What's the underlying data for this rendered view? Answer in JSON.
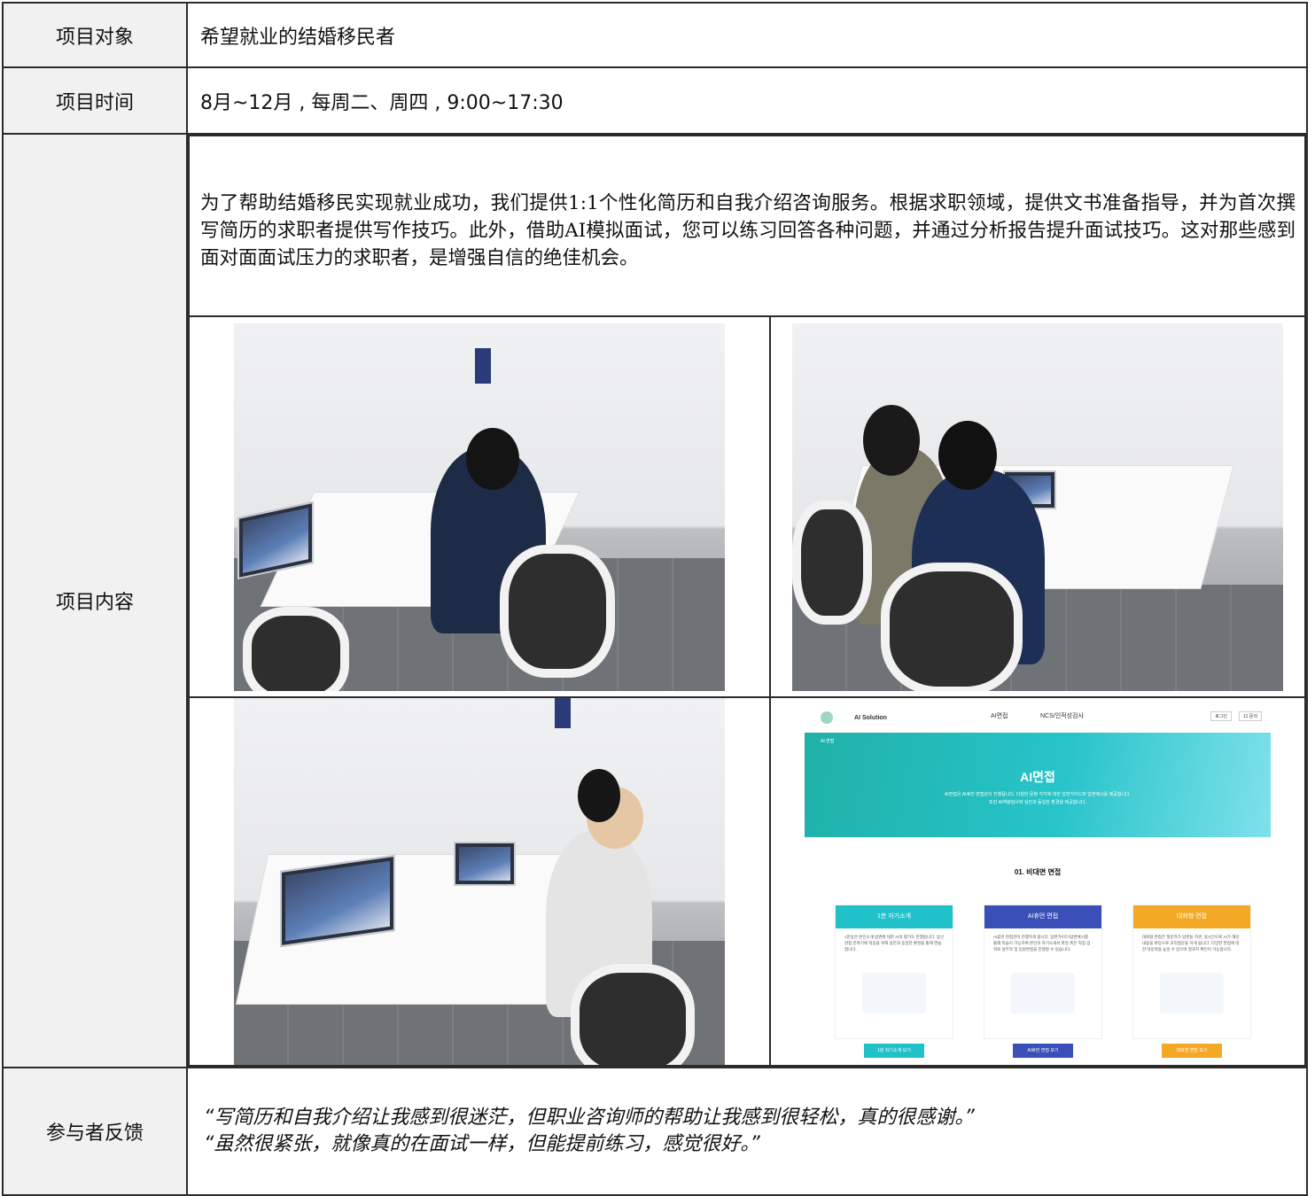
{
  "rows": {
    "target": {
      "label": "项目对象",
      "value": "希望就业的结婚移民者"
    },
    "time": {
      "label": "项目时间",
      "value": "8月~12月 , 每周二、周四 , 9:00~17:30"
    },
    "content": {
      "label": "项目内容",
      "paragraph": "为了帮助结婚移民实现就业成功，我们提供1:1个性化简历和自我介绍咨询服务。根据求职领域，提供文书准备指导，并为首次撰写简历的求职者提供写作技巧。此外，借助AI模拟面试，您可以练习回答各种问题，并通过分析报告提升面试技巧。这对那些感到面对面面试压力的求职者，是增强自信的绝佳机会。"
    },
    "feedback": {
      "label": "参与者反馈",
      "quotes": [
        "“写简历和自我介绍让我感到很迷茫，但职业咨询师的帮助让我感到很轻松，真的很感谢。”",
        "“虽然很紧张，就像真的在面试一样，但能提前练习，感觉很好。”"
      ]
    }
  },
  "website": {
    "brand": "AI Solution",
    "nav": [
      "AI면접",
      "NCS/인적성검사"
    ],
    "auth": [
      "로그인",
      "11 문의"
    ],
    "breadcrumb": "AI 면접",
    "hero_title": "AI면접",
    "hero_text_1": "AI면접은 AI휴먼 면접관이 진행됩니다. 다양한 문항 각각에 대한 답변가이드와 답변예시를 제공합니다.",
    "hero_text_2": "또한 AI역량검사와 실전과 동일한 환경을 제공합니다.",
    "section_title": "01. 비대면 면접",
    "cards": [
      {
        "title": "1분 자기소개",
        "desc": "1분동안 본인소개 답변에 대한 AI의 평가도 진행됩니다. 낯선 면접 분위기에 적응을 위해 실전과 동일한 환경을 통해 연습합니다.",
        "button": "1분 자기소개 보기",
        "color": "#21c1c9"
      },
      {
        "title": "AI휴먼 면접",
        "desc": "AI휴먼 면접관이 진행하게 됩니다. 답변가이드/답변예시를 통해 학습이 가능하여 본인의 자기소개서 파일 혹은 직접 입력로 실무자 및 임원면접을 진행할 수 있습니다.",
        "button": "AI휴먼 면접 보기",
        "color": "#3a4fb8"
      },
      {
        "title": "대화형 면접",
        "desc": "대화형 면접은 질문자가 답변을 하면, 실시간으로 AI가 해당 내용을 바탕으로 꼬리질문을 하게 됩니다. 다양한 면접에 대한 대응력을 높일 수 있으며 결과지 확인이 가능합니다.",
        "button": "대화형 면접 보기",
        "color": "#f4a926"
      }
    ],
    "colors": {
      "hero": "#27c4c9",
      "accent": "#21c1c9"
    }
  }
}
